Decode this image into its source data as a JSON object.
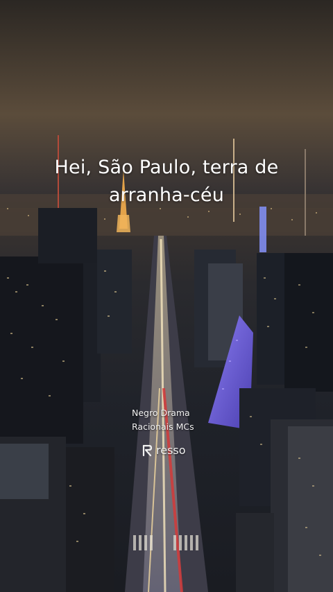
{
  "lyric": {
    "line1": "Hei, São Paulo, terra de",
    "line2": "arranha-céu"
  },
  "track": {
    "title": "Negro Drama",
    "artist": "Racionais MCs"
  },
  "watermark": {
    "brand": "resso",
    "icon": "resso-logo-icon"
  },
  "colors": {
    "sky_top": "#2a2622",
    "sky_glow": "#5a4b3a",
    "text": "#ffffff",
    "purple_tower": "#6a5cd8",
    "street_lights": "#f3d9a0",
    "traffic_red": "#d43a3a"
  }
}
